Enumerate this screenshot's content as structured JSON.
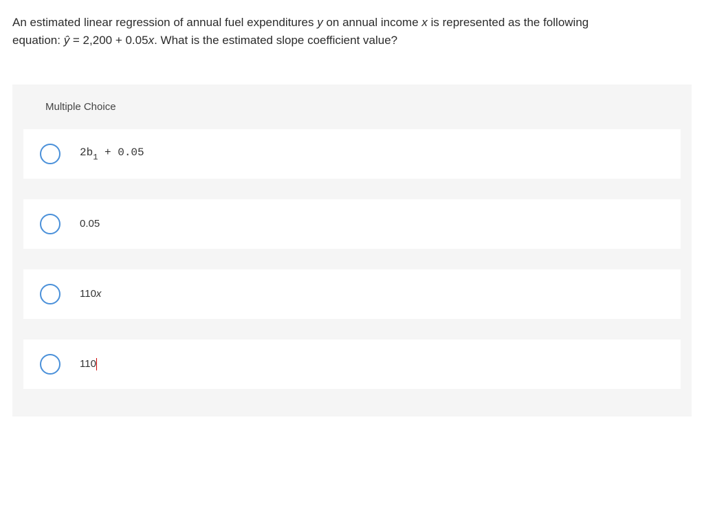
{
  "question": {
    "line1_a": "An estimated linear regression of annual fuel expenditures ",
    "line1_var_y": "y",
    "line1_b": " on annual income ",
    "line1_var_x": "x",
    "line1_c": " is represented as the following",
    "line2_a": "equation: ",
    "line2_yhat": "ŷ",
    "line2_b": " = 2,200 + 0.05",
    "line2_var_x": "x",
    "line2_c": ". What is the estimated slope coefficient value?"
  },
  "section_label": "Multiple Choice",
  "options": {
    "a": {
      "prefix": "2",
      "var": "b",
      "sub": "1",
      "suffix": " + 0.05"
    },
    "b": "0.05",
    "c": {
      "num": "110",
      "var": "x"
    },
    "d": "110"
  }
}
